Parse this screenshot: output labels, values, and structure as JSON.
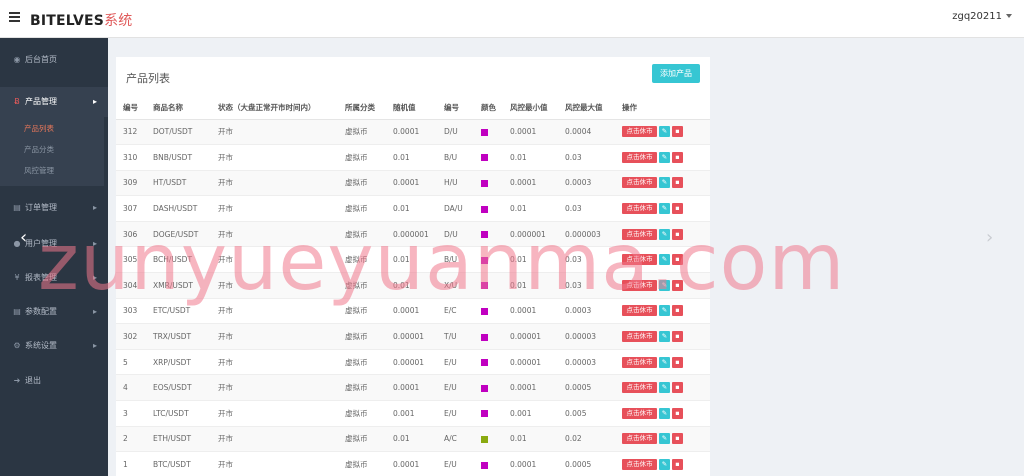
{
  "topbar": {
    "brand_main": "BITELVES",
    "brand_suffix": "系统",
    "username": "zgq20211"
  },
  "sidebar": {
    "items": [
      {
        "label": "后台首页",
        "icon": "dashboard-icon",
        "glyph": "◉"
      },
      {
        "label": "产品管理",
        "icon": "bitcoin-icon",
        "glyph": "Ƀ"
      },
      {
        "label": "订单管理",
        "icon": "copy-icon",
        "glyph": "▤"
      },
      {
        "label": "用户管理",
        "icon": "user-icon",
        "glyph": "●"
      },
      {
        "label": "报表管理",
        "icon": "yen-icon",
        "glyph": "¥"
      },
      {
        "label": "参数配置",
        "icon": "copy-icon",
        "glyph": "▤"
      },
      {
        "label": "系统设置",
        "icon": "gears-icon",
        "glyph": "⚙"
      },
      {
        "label": "退出",
        "icon": "sign-out-icon",
        "glyph": "➜"
      }
    ],
    "submenu": [
      "产品列表",
      "产品分类",
      "风控管理"
    ]
  },
  "main": {
    "title": "产品列表",
    "add_button": "添加产品",
    "columns": [
      "编号",
      "商品名称",
      "状态（大盘正常开市时间内）",
      "所属分类",
      "随机值",
      "编号",
      "颜色",
      "风控最小值",
      "风控最大值",
      "操作"
    ],
    "action_close_label": "点击休市",
    "action_edit_icon": "pencil-icon",
    "action_delete_icon": "trash-icon",
    "rows": [
      {
        "id": "312",
        "name": "DOT/USDT",
        "status": "开市",
        "category": "虚拟币",
        "rand": "0.0001",
        "code": "D/U",
        "color": "#c000c0",
        "min": "0.0001",
        "max": "0.0004"
      },
      {
        "id": "310",
        "name": "BNB/USDT",
        "status": "开市",
        "category": "虚拟币",
        "rand": "0.01",
        "code": "B/U",
        "color": "#c000c0",
        "min": "0.01",
        "max": "0.03"
      },
      {
        "id": "309",
        "name": "HT/USDT",
        "status": "开市",
        "category": "虚拟币",
        "rand": "0.0001",
        "code": "H/U",
        "color": "#c000c0",
        "min": "0.0001",
        "max": "0.0003"
      },
      {
        "id": "307",
        "name": "DASH/USDT",
        "status": "开市",
        "category": "虚拟币",
        "rand": "0.01",
        "code": "DA/U",
        "color": "#c000c0",
        "min": "0.01",
        "max": "0.03"
      },
      {
        "id": "306",
        "name": "DOGE/USDT",
        "status": "开市",
        "category": "虚拟币",
        "rand": "0.000001",
        "code": "D/U",
        "color": "#c000c0",
        "min": "0.000001",
        "max": "0.000003"
      },
      {
        "id": "305",
        "name": "BCH/USDT",
        "status": "开市",
        "category": "虚拟币",
        "rand": "0.01",
        "code": "B/U",
        "color": "#c000c0",
        "min": "0.01",
        "max": "0.03"
      },
      {
        "id": "304",
        "name": "XMR/USDT",
        "status": "开市",
        "category": "虚拟币",
        "rand": "0.01",
        "code": "X/U",
        "color": "#c000c0",
        "min": "0.01",
        "max": "0.03"
      },
      {
        "id": "303",
        "name": "ETC/USDT",
        "status": "开市",
        "category": "虚拟币",
        "rand": "0.0001",
        "code": "E/C",
        "color": "#c000c0",
        "min": "0.0001",
        "max": "0.0003"
      },
      {
        "id": "302",
        "name": "TRX/USDT",
        "status": "开市",
        "category": "虚拟币",
        "rand": "0.00001",
        "code": "T/U",
        "color": "#c000c0",
        "min": "0.00001",
        "max": "0.00003"
      },
      {
        "id": "5",
        "name": "XRP/USDT",
        "status": "开市",
        "category": "虚拟币",
        "rand": "0.00001",
        "code": "E/U",
        "color": "#c000c0",
        "min": "0.00001",
        "max": "0.00003"
      },
      {
        "id": "4",
        "name": "EOS/USDT",
        "status": "开市",
        "category": "虚拟币",
        "rand": "0.0001",
        "code": "E/U",
        "color": "#c000c0",
        "min": "0.0001",
        "max": "0.0005"
      },
      {
        "id": "3",
        "name": "LTC/USDT",
        "status": "开市",
        "category": "虚拟币",
        "rand": "0.001",
        "code": "E/U",
        "color": "#c000c0",
        "min": "0.001",
        "max": "0.005"
      },
      {
        "id": "2",
        "name": "ETH/USDT",
        "status": "开市",
        "category": "虚拟币",
        "rand": "0.01",
        "code": "A/C",
        "color": "#8aaa10",
        "min": "0.01",
        "max": "0.02"
      },
      {
        "id": "1",
        "name": "BTC/USDT",
        "status": "开市",
        "category": "虚拟币",
        "rand": "0.0001",
        "code": "E/U",
        "color": "#c000c0",
        "min": "0.0001",
        "max": "0.0005"
      }
    ]
  },
  "watermark": "zunyueyuanma.com"
}
